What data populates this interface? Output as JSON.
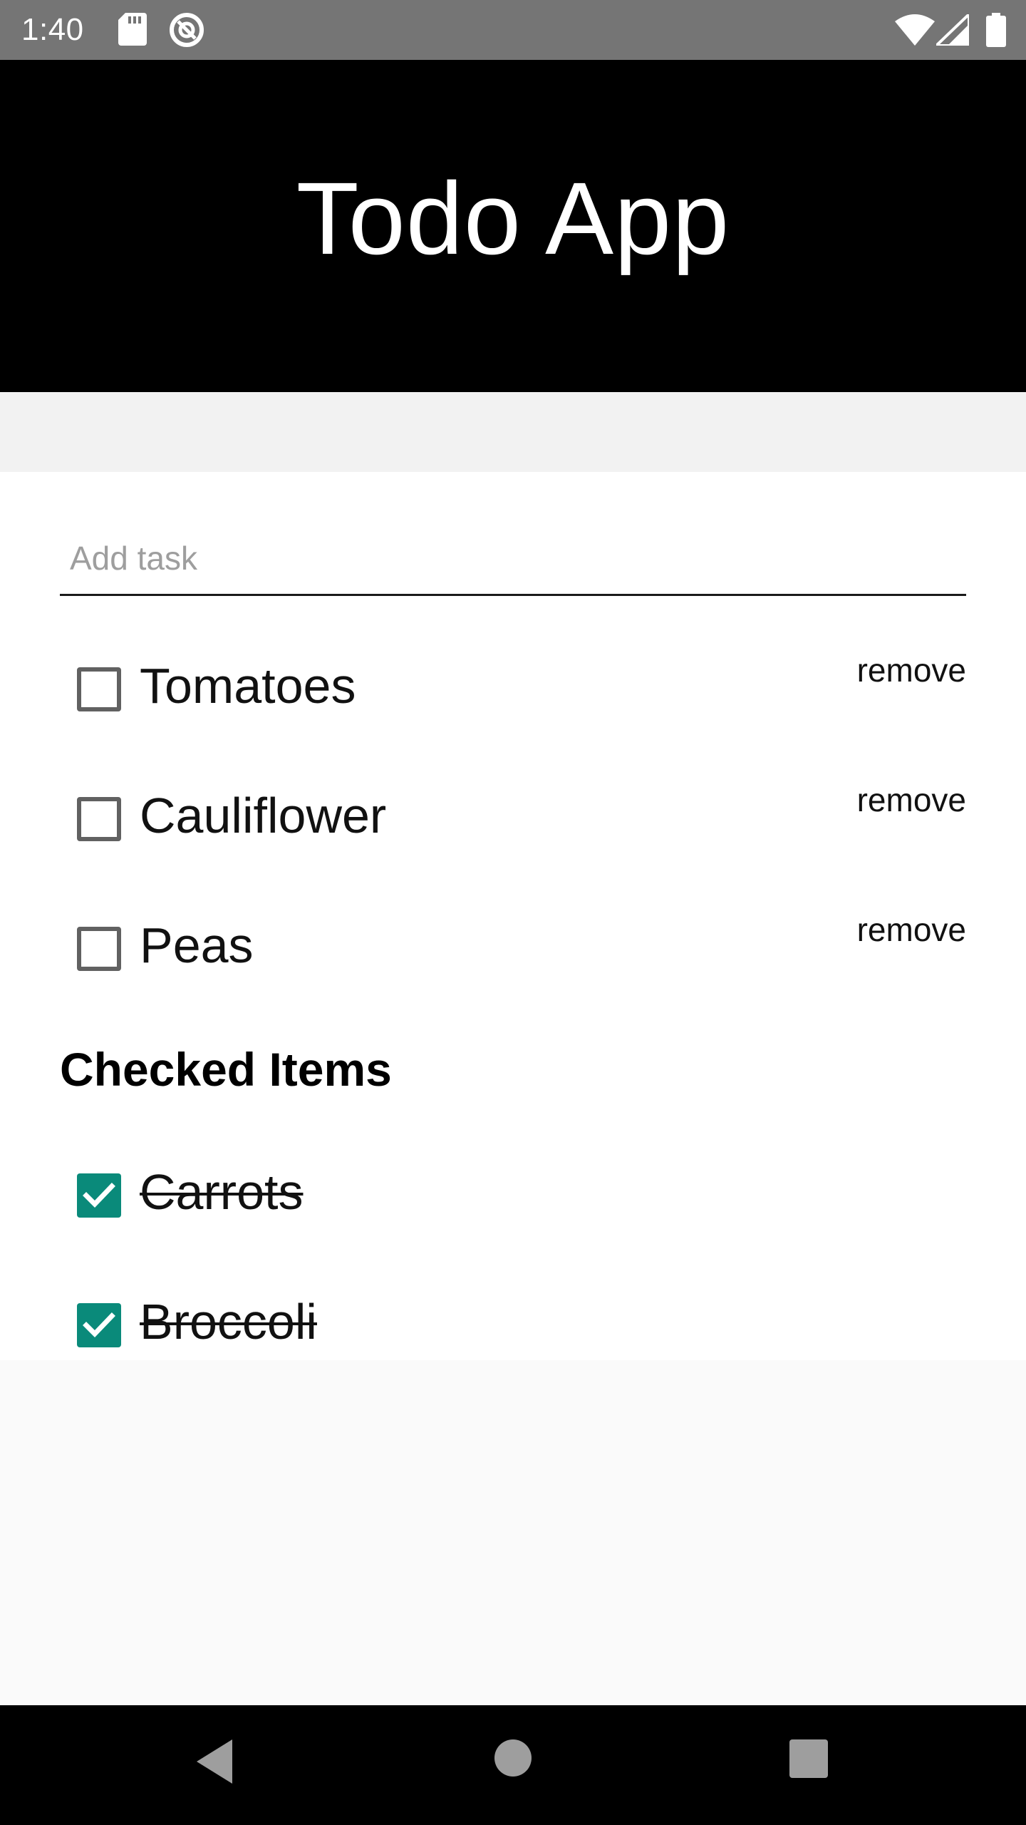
{
  "status_bar": {
    "time": "1:40",
    "icons": [
      "sd-card-icon",
      "sync-icon",
      "wifi-icon",
      "signal-icon",
      "battery-icon"
    ]
  },
  "header": {
    "title": "Todo App"
  },
  "input": {
    "placeholder": "Add task",
    "value": ""
  },
  "todo_items": [
    {
      "label": "Tomatoes",
      "checked": false,
      "remove_label": "remove"
    },
    {
      "label": "Cauliflower",
      "checked": false,
      "remove_label": "remove"
    },
    {
      "label": "Peas",
      "checked": false,
      "remove_label": "remove"
    }
  ],
  "checked_section": {
    "title": "Checked Items"
  },
  "checked_items": [
    {
      "label": "Carrots",
      "checked": true
    },
    {
      "label": "Broccoli",
      "checked": true
    }
  ],
  "nav_bar": {
    "buttons": [
      "back-icon",
      "home-icon",
      "recents-icon"
    ]
  },
  "colors": {
    "status_bar": "#757575",
    "header": "#000000",
    "checkbox_checked": "#0a8a7a",
    "nav_bar": "#000000"
  }
}
